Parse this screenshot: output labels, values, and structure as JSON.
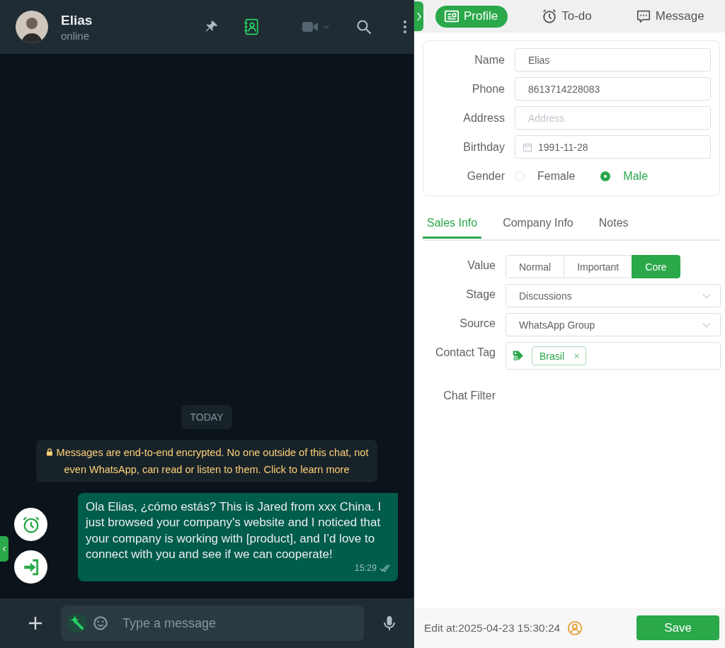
{
  "chat": {
    "contact": {
      "name": "Elias",
      "status": "online"
    },
    "day_label": "TODAY",
    "notice": "Messages are end-to-end encrypted. No one outside of this chat, not even WhatsApp, can read or listen to them. Click to learn more",
    "messages": [
      {
        "text": "Ola Elias, ¿cómo estás? This is Jared from xxx China. I just browsed your company's website and I noticed that your company is working with [product], and I’d love to connect with you and see if we can cooperate!",
        "time": "15:29"
      }
    ],
    "composer": {
      "placeholder": "Type a message"
    }
  },
  "panel": {
    "tabs": [
      {
        "label": "Profile",
        "kind": "card",
        "selected": true
      },
      {
        "label": "To-do",
        "kind": "clock",
        "selected": false
      },
      {
        "label": "Message",
        "kind": "chat",
        "selected": false
      }
    ],
    "profile": {
      "fields": [
        {
          "label": "Name",
          "kind": "text",
          "value": "Elias"
        },
        {
          "label": "Phone",
          "kind": "text",
          "value": "8613714228083"
        },
        {
          "label": "Address",
          "kind": "text",
          "placeholder": "Address"
        },
        {
          "label": "Birthday",
          "kind": "date",
          "value": "1991-11-28"
        }
      ],
      "gender": {
        "label": "Gender",
        "options": [
          {
            "label": "Female",
            "selected": false
          },
          {
            "label": "Male",
            "selected": true
          }
        ]
      }
    },
    "subtabs": [
      {
        "label": "Sales Info",
        "selected": true
      },
      {
        "label": "Company Info",
        "selected": false
      },
      {
        "label": "Notes",
        "selected": false
      }
    ],
    "sales": [
      {
        "label": "Value",
        "kind": "segmented",
        "options": [
          {
            "label": "Normal",
            "selected": false
          },
          {
            "label": "Important",
            "selected": false
          },
          {
            "label": "Core",
            "selected": true
          }
        ]
      },
      {
        "label": "Stage",
        "kind": "select",
        "value": "Discussions"
      },
      {
        "label": "Source",
        "kind": "select",
        "value": "WhatsApp Group"
      },
      {
        "label": "Contact Tag",
        "kind": "tags",
        "tags": [
          "Brasil"
        ]
      },
      {
        "label": "Chat Filter",
        "kind": "empty"
      }
    ],
    "footer": {
      "edited": "Edit at:2025-04-23 15:30:24",
      "save": "Save"
    }
  }
}
